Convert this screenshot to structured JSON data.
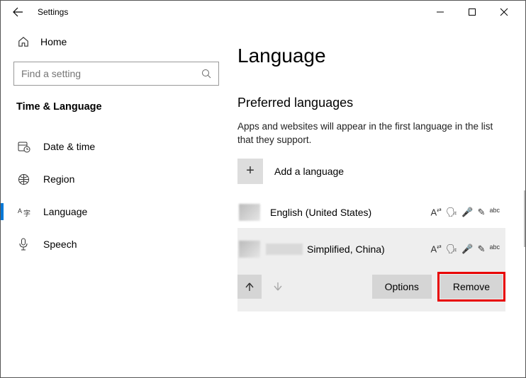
{
  "titlebar": {
    "appName": "Settings"
  },
  "sidebar": {
    "home": "Home",
    "searchPlaceholder": "Find a setting",
    "section": "Time & Language",
    "items": [
      {
        "label": "Date & time"
      },
      {
        "label": "Region"
      },
      {
        "label": "Language"
      },
      {
        "label": "Speech"
      }
    ]
  },
  "main": {
    "heading": "Language",
    "subheading": "Preferred languages",
    "description": "Apps and websites will appear in the first language in the list that they support.",
    "addLabel": "Add a language",
    "languages": [
      {
        "name": "English (United States)"
      },
      {
        "name": "Simplified, China)"
      }
    ],
    "buttons": {
      "options": "Options",
      "remove": "Remove"
    }
  }
}
